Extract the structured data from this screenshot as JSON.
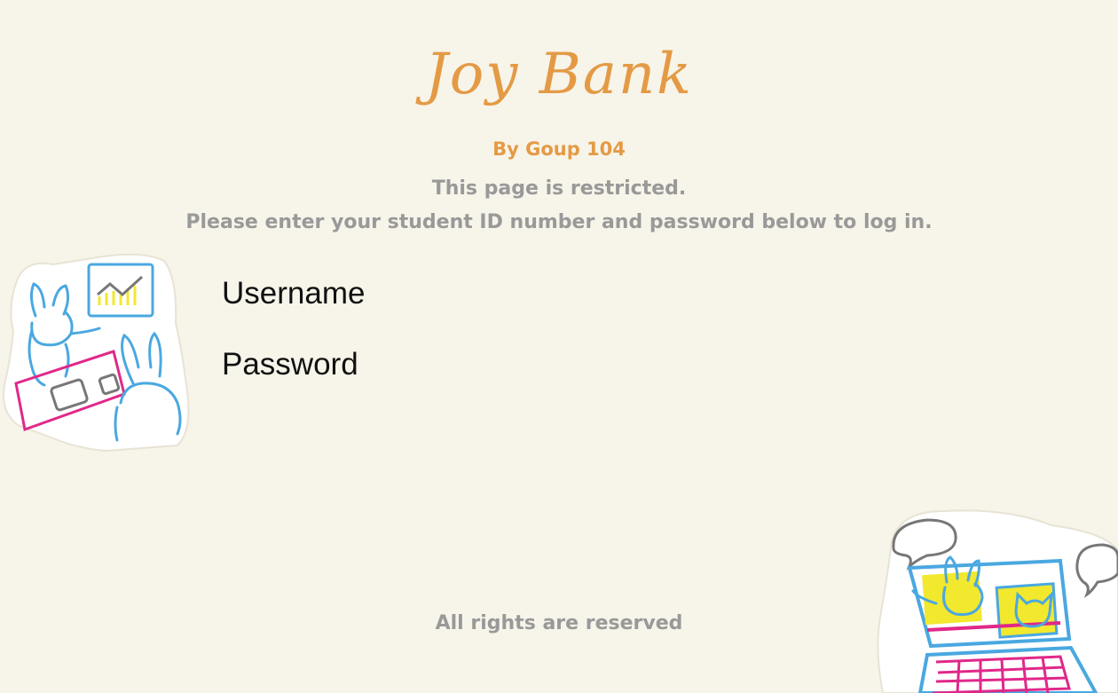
{
  "header": {
    "title": "Joy Bank",
    "subtitle": "By Goup 104"
  },
  "notice": {
    "line1": "This page is restricted.",
    "line2": "Please enter your student ID number and password below to log in."
  },
  "login_form": {
    "username_label": "Username",
    "password_label": "Password"
  },
  "footer": {
    "text": "All rights are reserved"
  },
  "colors": {
    "background": "#f7f4e9",
    "accent": "#e49a45",
    "muted_text": "#999999",
    "illustration_blue": "#4aa8e0",
    "illustration_pink": "#e0288a",
    "illustration_yellow": "#f2e82e"
  }
}
